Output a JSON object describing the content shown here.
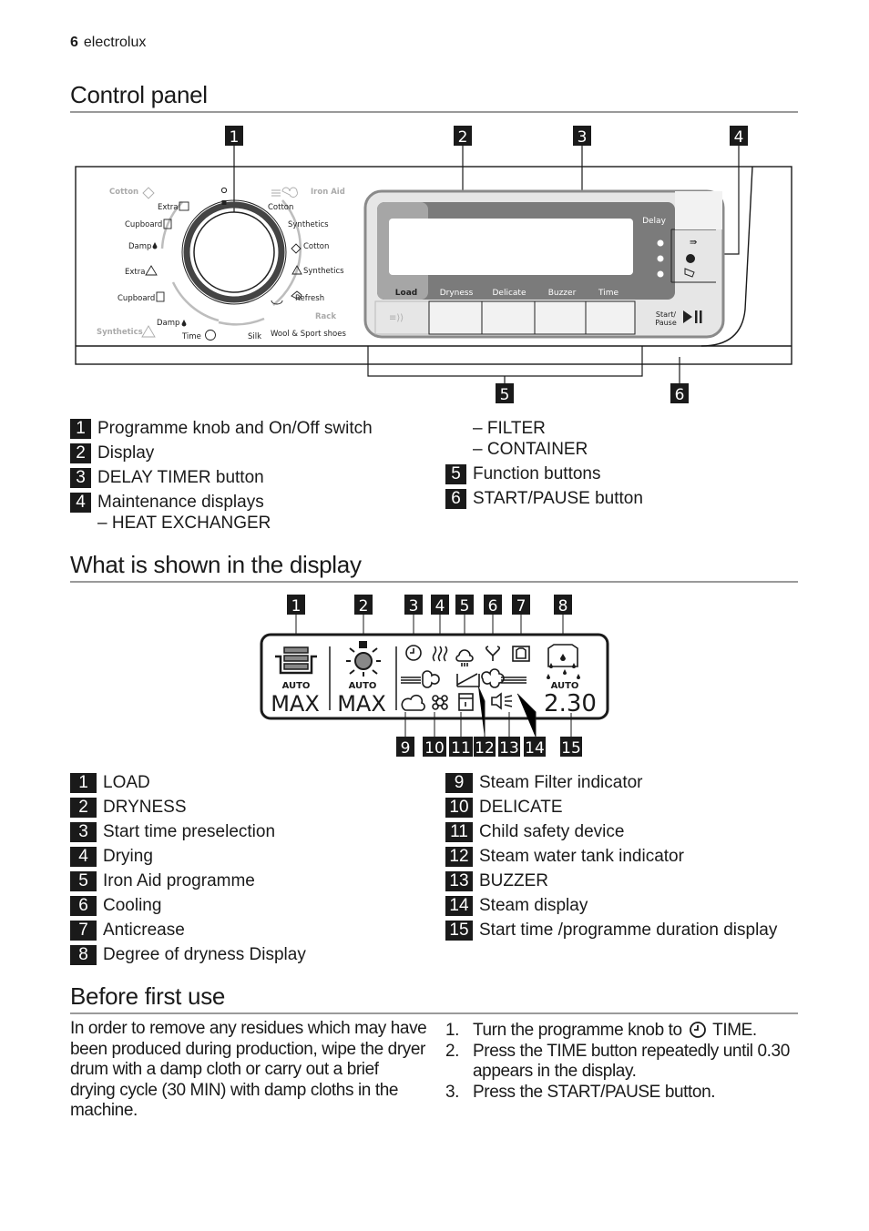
{
  "header": {
    "page_number": "6",
    "brand": "electrolux"
  },
  "sections": {
    "control_panel": "Control panel",
    "display": "What is shown in the display",
    "first_use": "Before first use"
  },
  "panel": {
    "callouts": [
      "1",
      "2",
      "3",
      "4",
      "5",
      "6"
    ],
    "knob_labels": {
      "cotton_group": "Cotton",
      "synthetics_group": "Synthetics",
      "iron_aid": "Iron Aid",
      "extra_cotton": "Extra",
      "cupboard_cotton": "Cupboard",
      "damp_cotton": "Damp",
      "extra_synth": "Extra",
      "cupboard_synth": "Cupboard",
      "damp_synth": "Damp",
      "time": "Time",
      "silk": "Silk",
      "wool_sport": "Wool & Sport shoes",
      "rack": "Rack",
      "refresh": "Refresh",
      "synthetics_r": "Synthetics",
      "cotton_r": "Cotton",
      "steam_synthetics": "Synthetics",
      "steam_cotton": "Cotton"
    },
    "buttons": {
      "delay": "Delay",
      "load": "Load",
      "dryness": "Dryness",
      "delicate": "Delicate",
      "buzzer": "Buzzer",
      "time": "Time",
      "start_pause_1": "Start/",
      "start_pause_2": "Pause"
    }
  },
  "panel_legend": {
    "left": [
      {
        "num": "1",
        "label": "Programme knob and On/Off switch"
      },
      {
        "num": "2",
        "label": "Display"
      },
      {
        "num": "3",
        "label": "DELAY TIMER button"
      },
      {
        "num": "4",
        "label": "Maintenance displays"
      }
    ],
    "sub_items": [
      "–  HEAT EXCHANGER",
      "–  FILTER",
      "–  CONTAINER"
    ],
    "right": [
      {
        "num": "5",
        "label": "Function buttons"
      },
      {
        "num": "6",
        "label": "START/PAUSE button"
      }
    ]
  },
  "display": {
    "callouts_top": [
      "1",
      "2",
      "3",
      "4",
      "5",
      "6",
      "7",
      "8"
    ],
    "callouts_bottom": [
      "9",
      "10",
      "11",
      "12",
      "13",
      "14",
      "15"
    ],
    "auto": "AUTO",
    "load_value": "MAX",
    "dryness_value": "MAX",
    "time_value": "2.30"
  },
  "display_legend": {
    "left": [
      {
        "num": "1",
        "label": "LOAD"
      },
      {
        "num": "2",
        "label": "DRYNESS"
      },
      {
        "num": "3",
        "label": "Start time preselection"
      },
      {
        "num": "4",
        "label": "Drying"
      },
      {
        "num": "5",
        "label": "Iron Aid programme"
      },
      {
        "num": "6",
        "label": "Cooling"
      },
      {
        "num": "7",
        "label": "Anticrease"
      },
      {
        "num": "8",
        "label": "Degree of dryness Display"
      }
    ],
    "right": [
      {
        "num": "9",
        "label": "Steam Filter indicator"
      },
      {
        "num": "10",
        "label": "DELICATE"
      },
      {
        "num": "11",
        "label": "Child safety device"
      },
      {
        "num": "12",
        "label": "Steam water tank indicator"
      },
      {
        "num": "13",
        "label": "BUZZER"
      },
      {
        "num": "14",
        "label": "Steam display"
      },
      {
        "num": "15",
        "label": "Start time /programme duration display"
      }
    ]
  },
  "first_use": {
    "paragraph": "In order to remove any residues which may have been produced during production, wipe the dryer drum with a damp cloth or carry out a brief drying cycle (30 MIN) with damp cloths in the machine.",
    "steps": [
      {
        "num": "1.",
        "before": "Turn the programme knob to",
        "icon": "clock-icon",
        "after": "TIME."
      },
      {
        "num": "2.",
        "text": "Press the TIME button repeatedly until 0.30 appears in the display."
      },
      {
        "num": "3.",
        "text": "Press the START/PAUSE button."
      }
    ]
  }
}
